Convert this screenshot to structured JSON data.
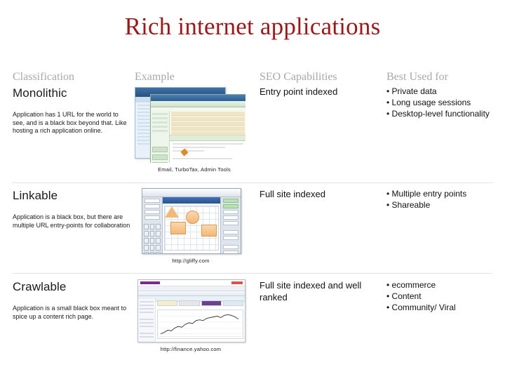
{
  "slide": {
    "title": "Rich internet applications",
    "title_color": "#9c1818",
    "background": "#ffffff"
  },
  "table": {
    "headers": [
      {
        "id": "classification",
        "label": "Classification"
      },
      {
        "id": "example",
        "label": "Example"
      },
      {
        "id": "seo",
        "label": "SEO Capabilities"
      },
      {
        "id": "best",
        "label": "Best Used for"
      }
    ],
    "header_color": "#a8a8a8",
    "divider_color": "#dfe3e6",
    "rows": [
      {
        "id": "monolithic",
        "classification": "Monolithic",
        "description": "Application has 1 URL for the world to see, and is a black box beyond that. Like hosting a rich application online.",
        "example_caption": "Email, TurboTax, Admin Tools",
        "example_thumbnail": "stacked-app-windows-screenshot",
        "seo": "Entry point indexed",
        "best_used_for": [
          "• Private data",
          "• Long usage sessions",
          "• Desktop-level functionality"
        ]
      },
      {
        "id": "linkable",
        "classification": "Linkable",
        "description": "Application is a black box, but there are multiple URL entry-points for collaboration",
        "example_caption": "http://gliffy.com",
        "example_thumbnail": "gliffy-diagram-editor-screenshot",
        "seo": "Full site indexed",
        "best_used_for": [
          "• Multiple entry points",
          "• Shareable"
        ]
      },
      {
        "id": "crawlable",
        "classification": "Crawlable",
        "description": "Application is a small black box meant to spice up a content rich page.",
        "example_caption": "http://finance.yahoo.com",
        "example_thumbnail": "yahoo-finance-chart-screenshot",
        "seo": "Full site indexed and well ranked",
        "best_used_for": [
          "• ecommerce",
          "• Content",
          "• Community/ Viral"
        ]
      }
    ]
  }
}
